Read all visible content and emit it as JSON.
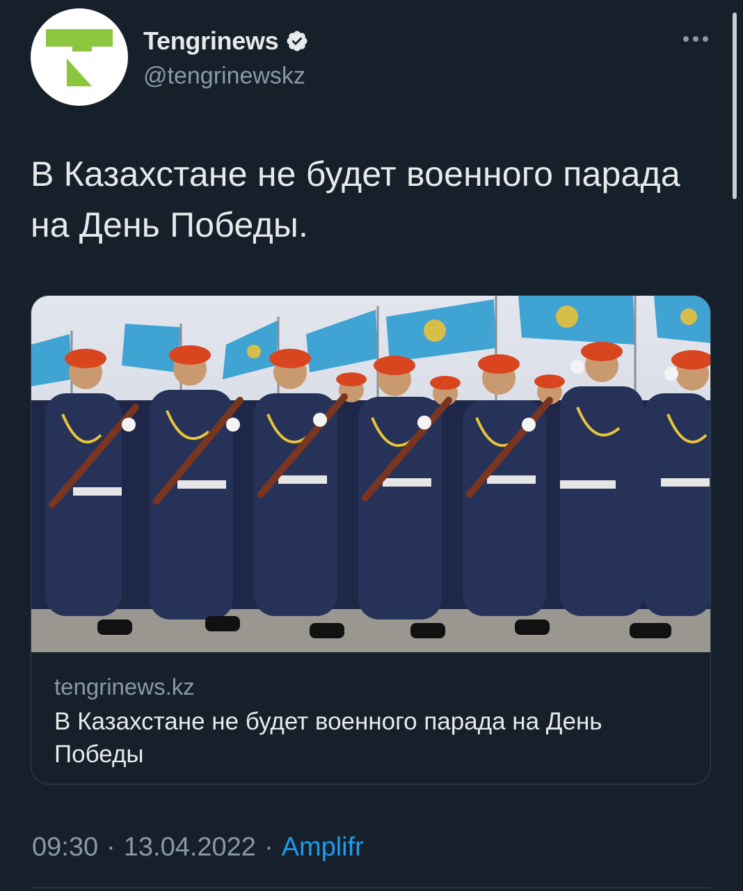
{
  "author": {
    "display_name": "Tengrinews",
    "handle": "@tengrinewskz",
    "verified_icon": "verified-badge-icon",
    "avatar_icon": "tengrinews-logo-icon"
  },
  "tweet": {
    "text": "В Казахстане не будет военного парада на День Победы."
  },
  "card": {
    "image_icon": "military-parade-photo",
    "domain": "tengrinews.kz",
    "title": "В Казахстане не будет военного парада на День Победы"
  },
  "footer": {
    "time": "09:30",
    "date": "13.04.2022",
    "separator": "·",
    "app": "Amplifr"
  },
  "colors": {
    "background": "#15202b",
    "text": "#e7e9ea",
    "secondary": "#8b98a5",
    "link": "#1d9bf0",
    "border": "#38444d",
    "logo_green": "#8cc63f"
  }
}
